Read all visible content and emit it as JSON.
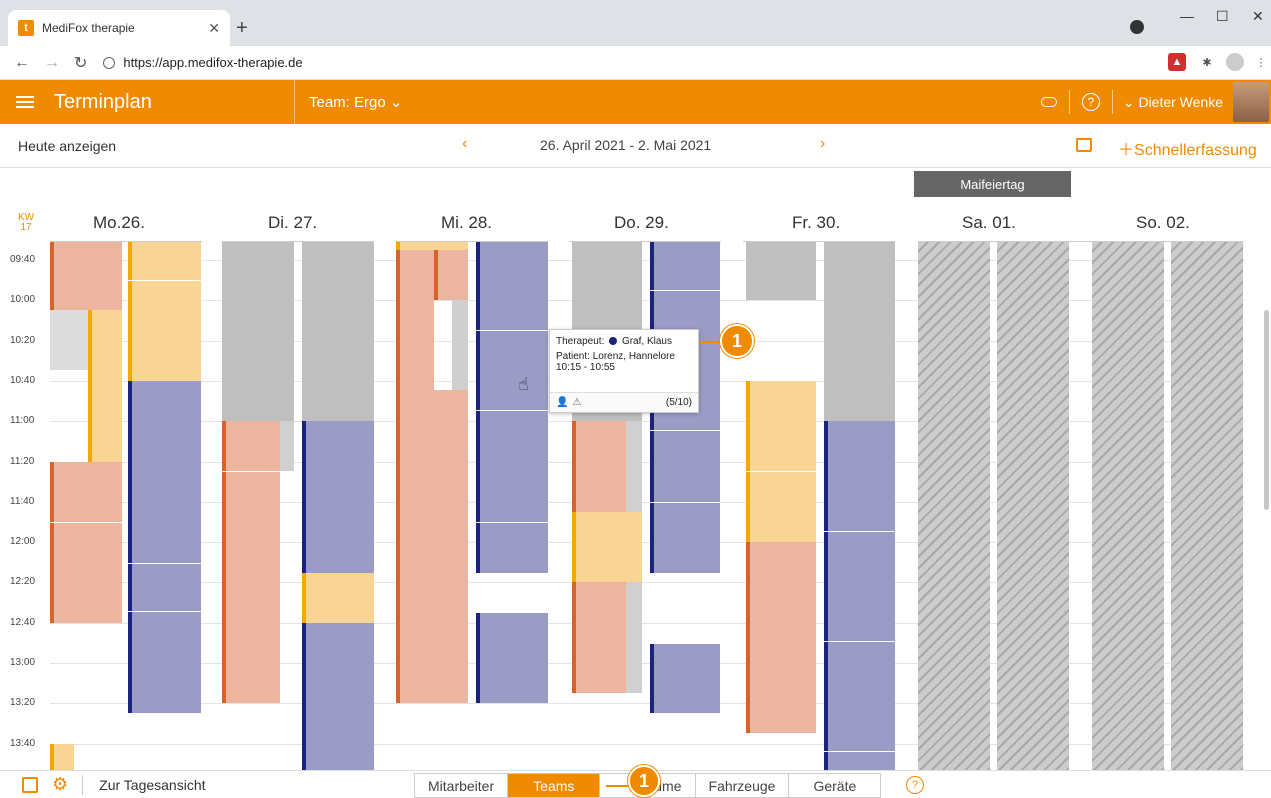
{
  "browser": {
    "tab_title": "MediFox therapie",
    "favicon_letter": "t",
    "url": "https://app.medifox-therapie.de"
  },
  "header": {
    "app_title": "Terminplan",
    "team_label": "Team: Ergo",
    "user_name": "Dieter Wenke",
    "help_icon": "?"
  },
  "toolbar": {
    "today_label": "Heute anzeigen",
    "date_range": "26. April 2021 - 2. Mai 2021",
    "prev": "‹",
    "next": "›",
    "quick_entry": "Schnellerfassung"
  },
  "calendar": {
    "holiday_label": "Maifeiertag",
    "kw_label": "KW",
    "kw_number": "17",
    "days": [
      "Mo.26.",
      "Di. 27.",
      "Mi. 28.",
      "Do. 29.",
      "Fr. 30.",
      "Sa. 01.",
      "So. 02."
    ],
    "times": [
      "09:40",
      "10:00",
      "10:20",
      "10:40",
      "11:00",
      "11:20",
      "11:40",
      "12:00",
      "12:20",
      "12:40",
      "13:00",
      "13:20",
      "13:40"
    ]
  },
  "tooltip": {
    "therapist_label": "Therapeut:",
    "therapist_name": "Graf, Klaus",
    "patient": "Patient: Lorenz, Hannelore",
    "time": "10:15 - 10:55",
    "count": "(5/10)",
    "badge": "1"
  },
  "bottombar": {
    "day_view": "Zur Tagesansicht",
    "segments": [
      "Mitarbeiter",
      "Teams",
      "Räume",
      "Fahrzeuge",
      "Geräte"
    ],
    "badge": "1",
    "help": "?"
  },
  "colors": {
    "brand": "#f08a00",
    "salmon": "#ebb59f",
    "peach": "#f8d595",
    "lavender": "#9a9cc6",
    "gray": "#bfbfbf",
    "navy": "#1a237e",
    "rust": "#d9622b"
  }
}
